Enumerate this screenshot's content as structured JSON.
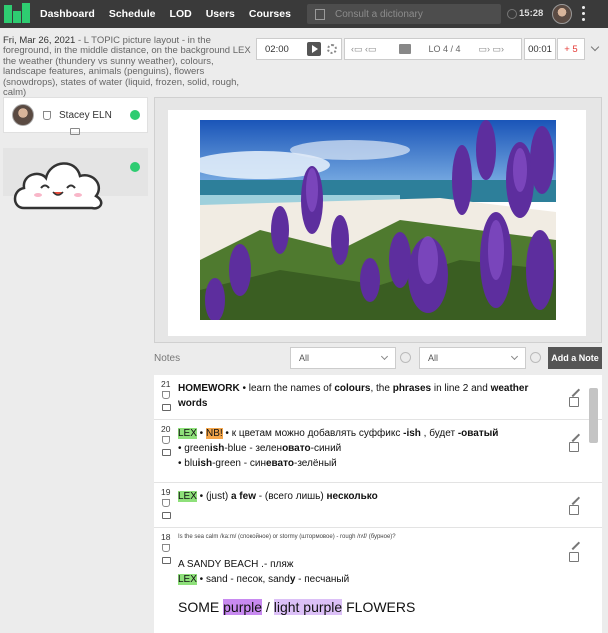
{
  "nav": {
    "items": [
      "Dashboard",
      "Schedule",
      "LOD",
      "Users",
      "Courses"
    ],
    "search_placeholder": "Consult a dictionary",
    "time": "15:28"
  },
  "topic": {
    "date": "Fri, Mar 26, 2021",
    "text": " - L TOPIC picture layout - in the foreground, in the middle distance, on the background LEX the weather (thundery vs sunny weather), colours, landscape features, animals (penguins), flowers (snowdrops), states of water (liquid, frozen, solid, rough, calm)"
  },
  "controls": {
    "timer": "02:00",
    "lo_label": "LO 4 / 4",
    "counter": "00:01",
    "points": "+ 5"
  },
  "students": [
    {
      "name": "Stacey ELN"
    }
  ],
  "notes_panel": {
    "title": "Notes",
    "filter1": "All",
    "filter2": "All",
    "add_button": "Add a Note"
  },
  "notes": [
    {
      "num": "21",
      "parts": [
        {
          "t": "HOMEWORK",
          "b": true
        },
        {
          "t": " •  learn the names of "
        },
        {
          "t": "colours",
          "b": true
        },
        {
          "t": ", the "
        },
        {
          "t": "phrases",
          "b": true
        },
        {
          "t": " in line 2 and "
        },
        {
          "t": "weather words",
          "b": true
        }
      ]
    },
    {
      "num": "20",
      "line1": {
        "lex": "LEX",
        "nb": "NB!",
        "text": " • к цветам можно добавлять суффикс ",
        "s1": "-ish",
        "mid": " , будет ",
        "s2": "-оватый"
      },
      "line2": {
        "a": "• green",
        "ab": "ish",
        "b": "-blue  - зелен",
        "bb": "овато",
        "c": "-синий"
      },
      "line3": {
        "a": "• blu",
        "ab": "ish",
        "b": "-green - син",
        "bb": "евато",
        "c": "-зелёный"
      }
    },
    {
      "num": "19",
      "lex": "LEX",
      "text1": " • (just) ",
      "b1": "a few",
      "text2": " - (всего лишь) ",
      "b2": "несколько"
    },
    {
      "num": "18",
      "small": "Is the sea calm /ka:m/ (спокойное) or stormy (штормовое) - rough /rʌf/ (бурное)?",
      "l1": "A SANDY BEACH .- пляж",
      "l2a": "LEX",
      "l2b": " • sand - песок, sand",
      "l2c": "y",
      "l2d": " - песчаный",
      "big_a": "SOME ",
      "big_b": "purple",
      "big_c": " / ",
      "big_d": "light purple",
      "big_e": " FLOWERS"
    }
  ]
}
